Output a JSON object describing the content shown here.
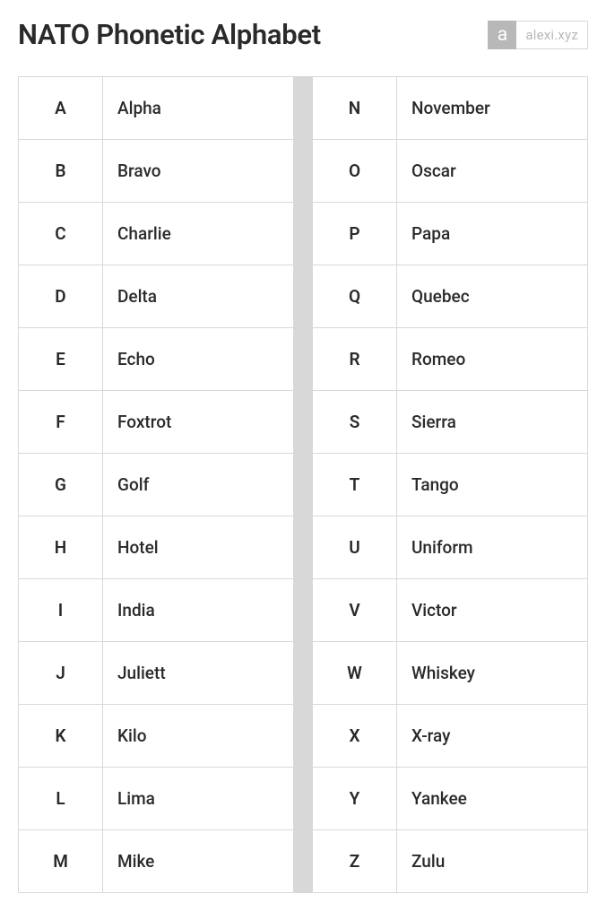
{
  "title": "NATO Phonetic Alphabet",
  "brand": {
    "icon_text": "a",
    "text": "alexi.xyz"
  },
  "left_column": [
    {
      "letter": "A",
      "word": "Alpha"
    },
    {
      "letter": "B",
      "word": "Bravo"
    },
    {
      "letter": "C",
      "word": "Charlie"
    },
    {
      "letter": "D",
      "word": "Delta"
    },
    {
      "letter": "E",
      "word": "Echo"
    },
    {
      "letter": "F",
      "word": "Foxtrot"
    },
    {
      "letter": "G",
      "word": "Golf"
    },
    {
      "letter": "H",
      "word": "Hotel"
    },
    {
      "letter": "I",
      "word": "India"
    },
    {
      "letter": "J",
      "word": "Juliett"
    },
    {
      "letter": "K",
      "word": "Kilo"
    },
    {
      "letter": "L",
      "word": "Lima"
    },
    {
      "letter": "M",
      "word": "Mike"
    }
  ],
  "right_column": [
    {
      "letter": "N",
      "word": "November"
    },
    {
      "letter": "O",
      "word": "Oscar"
    },
    {
      "letter": "P",
      "word": "Papa"
    },
    {
      "letter": "Q",
      "word": "Quebec"
    },
    {
      "letter": "R",
      "word": "Romeo"
    },
    {
      "letter": "S",
      "word": "Sierra"
    },
    {
      "letter": "T",
      "word": "Tango"
    },
    {
      "letter": "U",
      "word": "Uniform"
    },
    {
      "letter": "V",
      "word": "Victor"
    },
    {
      "letter": "W",
      "word": "Whiskey"
    },
    {
      "letter": "X",
      "word": "X-ray"
    },
    {
      "letter": "Y",
      "word": "Yankee"
    },
    {
      "letter": "Z",
      "word": "Zulu"
    }
  ]
}
